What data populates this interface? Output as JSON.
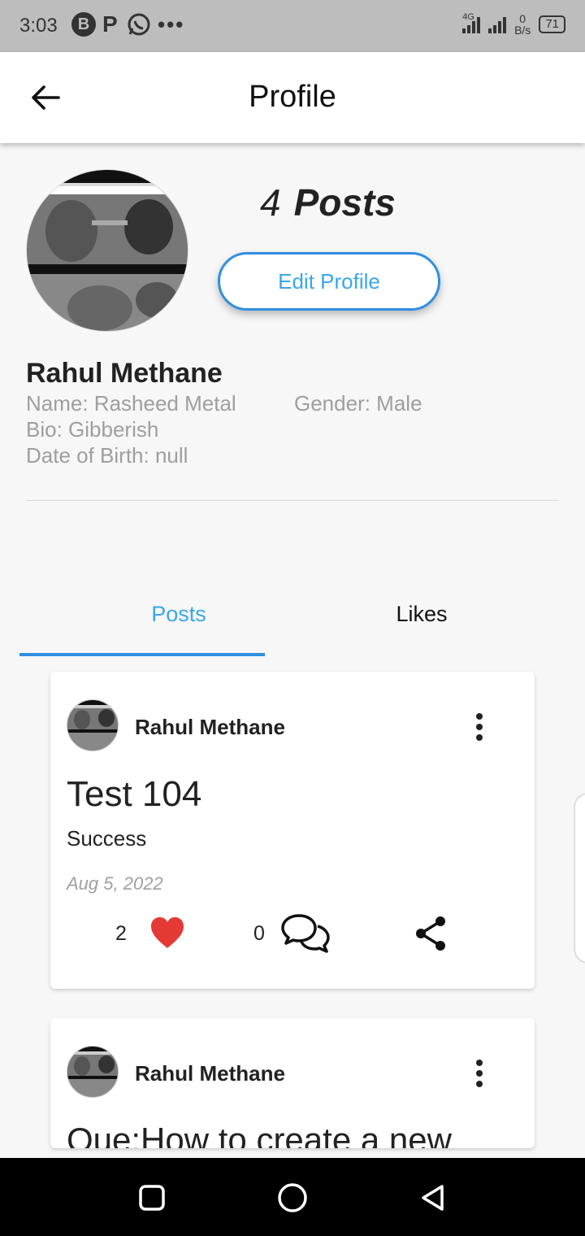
{
  "status_bar": {
    "time": "3:03",
    "notif_b": "B",
    "notif_p": "P",
    "dots": "•••",
    "network_type": "4G",
    "speed_value": "0",
    "speed_unit": "B/s",
    "battery": "71"
  },
  "app_bar": {
    "title": "Profile",
    "back_icon": "arrow-left-icon"
  },
  "profile": {
    "posts_count": "4",
    "posts_label": "Posts",
    "edit_button": "Edit Profile",
    "display_name": "Rahul Methane",
    "name_line": "Name: Rasheed Metal",
    "gender_line": "Gender: Male",
    "bio_line": "Bio: Gibberish",
    "dob_line": "Date of Birth: null"
  },
  "tabs": [
    {
      "label": "Posts",
      "active": true
    },
    {
      "label": "Likes",
      "active": false
    }
  ],
  "posts": [
    {
      "author": "Rahul Methane",
      "title": "Test 104",
      "body": "Success",
      "date": "Aug 5, 2022",
      "likes": "2",
      "comments": "0"
    },
    {
      "author": "Rahul Methane",
      "title": "Que:How to create a new"
    }
  ],
  "colors": {
    "accent": "#39a7ec",
    "indicator": "#2f8fe0",
    "heart": "#e53935"
  },
  "nav": {
    "recent_icon": "square-icon",
    "home_icon": "circle-icon",
    "back_icon": "triangle-back-icon"
  }
}
